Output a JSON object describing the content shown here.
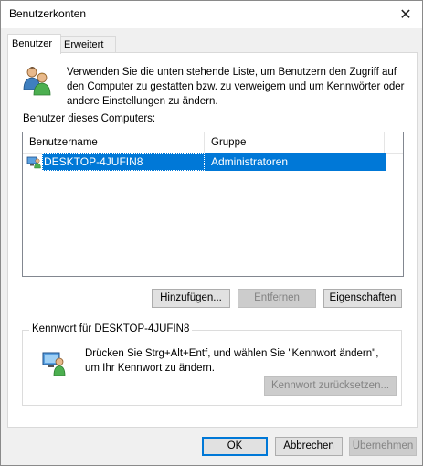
{
  "window": {
    "title": "Benutzerkonten",
    "close_symbol": "✕"
  },
  "tabs": [
    {
      "label": "Benutzer",
      "active": true
    },
    {
      "label": "Erweitert",
      "active": false
    }
  ],
  "intro_text": "Verwenden Sie die unten stehende Liste, um Benutzern den Zugriff auf den Computer zu gestatten bzw. zu verweigern und um Kennwörter oder andere Einstellungen zu ändern.",
  "users_list": {
    "label": "Benutzer dieses Computers:",
    "columns": [
      "Benutzername",
      "Gruppe"
    ],
    "rows": [
      {
        "username": "DESKTOP-4JUFIN8",
        "group": "Administratoren",
        "selected": true
      }
    ]
  },
  "user_buttons": {
    "add": "Hinzufügen...",
    "remove": "Entfernen",
    "properties": "Eigenschaften"
  },
  "password_group": {
    "title": "Kennwort für DESKTOP-4JUFIN8",
    "text": "Drücken Sie Strg+Alt+Entf, und wählen Sie \"Kennwort ändern\", um Ihr Kennwort zu ändern.",
    "reset_button": "Kennwort zurücksetzen..."
  },
  "footer_buttons": {
    "ok": "OK",
    "cancel": "Abbrechen",
    "apply": "Übernehmen"
  },
  "colors": {
    "selection": "#0078d7",
    "window_bg": "#f0f0f0",
    "panel_bg": "#ffffff"
  },
  "icons": {
    "users": "users-icon",
    "user_row": "computer-user-icon",
    "password": "password-user-icon"
  }
}
